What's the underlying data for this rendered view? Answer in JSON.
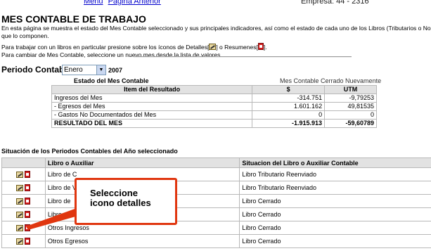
{
  "top": {
    "links": [
      "Menú",
      "Página Anterior"
    ],
    "empresa": "Empresa: 44 - 2316"
  },
  "title": "MES CONTABLE DE TRABAJO",
  "intro": {
    "line1": "En esta página se muestra el estado del Mes Contable seleccionado y sus principales indicadores, así como el estado de cada uno de los Libros (Tributarios o No",
    "line2": "que lo componen.",
    "line3_a": "Para trabajar con un libros en particular presione sobre los íconos de Detalles[",
    "line3_b": "] o Resumenes[",
    "line3_c": "].",
    "line4": "Para cambiar de Mes Contable, seleccione un nuevo mes desde la lista de valores."
  },
  "periodo": {
    "label": "Periodo Contable",
    "month": "Enero",
    "year": "2007"
  },
  "estado": {
    "label": "Estado del Mes Contable",
    "value": "Mes Contable Cerrado Nuevamente"
  },
  "resultados": {
    "headers": [
      "Item del Resultado",
      "$",
      "UTM"
    ],
    "rows": [
      [
        "Ingresos del Mes",
        "-314.751",
        "-9,79253"
      ],
      [
        "- Egresos del Mes",
        "1.601.162",
        "49,81535"
      ],
      [
        "- Gastos No Documentados del Mes",
        "0",
        "0"
      ]
    ],
    "total": [
      "RESULTADO DEL MES",
      "-1.915.913",
      "-59,60789"
    ]
  },
  "situacion": {
    "title": "Situación de los Periodos Contables del Año seleccionado",
    "headers": [
      "",
      "Libro o Auxiliar",
      "Situacion del Libro o Auxiliar Contable"
    ],
    "rows": [
      [
        "Libro de C",
        "Libro Tributario Reenviado"
      ],
      [
        "Libro de V",
        "Libro Tributario Reenviado"
      ],
      [
        "Libro de",
        "Libro Cerrado"
      ],
      [
        "Libro de R",
        "Libro Cerrado"
      ],
      [
        "Otros Ingresos",
        "Libro Cerrado"
      ],
      [
        "Otros Egresos",
        "Libro Cerrado"
      ]
    ]
  },
  "callout": {
    "line1": "Seleccione",
    "line2": "icono detalles"
  },
  "icons": {
    "details": "edit-details-icon",
    "summary": "pdf-summary-icon",
    "select_arrow": "chevron-down-icon"
  },
  "colors": {
    "callout_border": "#e0360f",
    "header_bg": "#e2e2e2",
    "link": "#0000cc"
  }
}
